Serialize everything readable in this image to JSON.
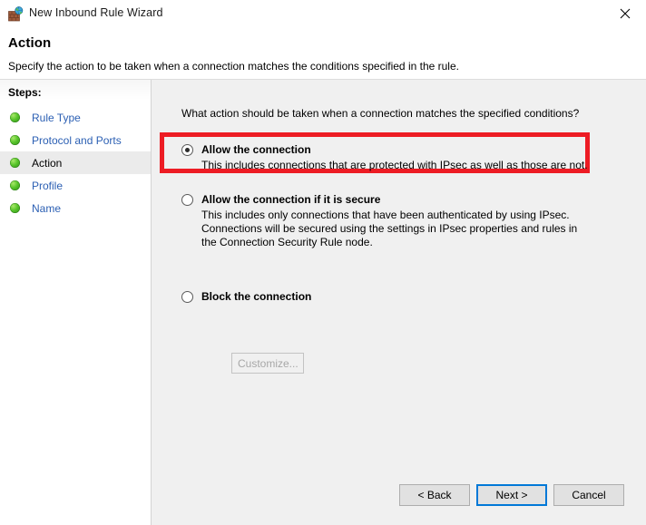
{
  "window": {
    "title": "New Inbound Rule Wizard",
    "icon": "firewall-globe-icon",
    "close_label": "✕"
  },
  "header": {
    "title": "Action",
    "subtitle": "Specify the action to be taken when a connection matches the conditions specified in the rule."
  },
  "sidebar": {
    "label": "Steps:",
    "items": [
      {
        "label": "Rule Type",
        "current": false
      },
      {
        "label": "Protocol and Ports",
        "current": false
      },
      {
        "label": "Action",
        "current": true
      },
      {
        "label": "Profile",
        "current": false
      },
      {
        "label": "Name",
        "current": false
      }
    ]
  },
  "main": {
    "question": "What action should be taken when a connection matches the specified conditions?",
    "options": [
      {
        "id": "allow",
        "title": "Allow the connection",
        "description": "This includes connections that are protected with IPsec as well as those are not.",
        "selected": true,
        "highlighted": true
      },
      {
        "id": "secure",
        "title": "Allow the connection if it is secure",
        "description": "This includes only connections that have been authenticated by using IPsec.  Connections will be secured using the settings in IPsec properties and rules in the Connection Security Rule node.",
        "selected": false,
        "highlighted": false
      },
      {
        "id": "block",
        "title": "Block the connection",
        "description": "",
        "selected": false,
        "highlighted": false
      }
    ],
    "customize_label": "Customize..."
  },
  "footer": {
    "back_label": "< Back",
    "next_label": "Next >",
    "cancel_label": "Cancel"
  },
  "colors": {
    "highlight": "#ed1c24",
    "focus": "#0078d7",
    "link": "#2b5fb3",
    "panel": "#f0f0f0"
  }
}
